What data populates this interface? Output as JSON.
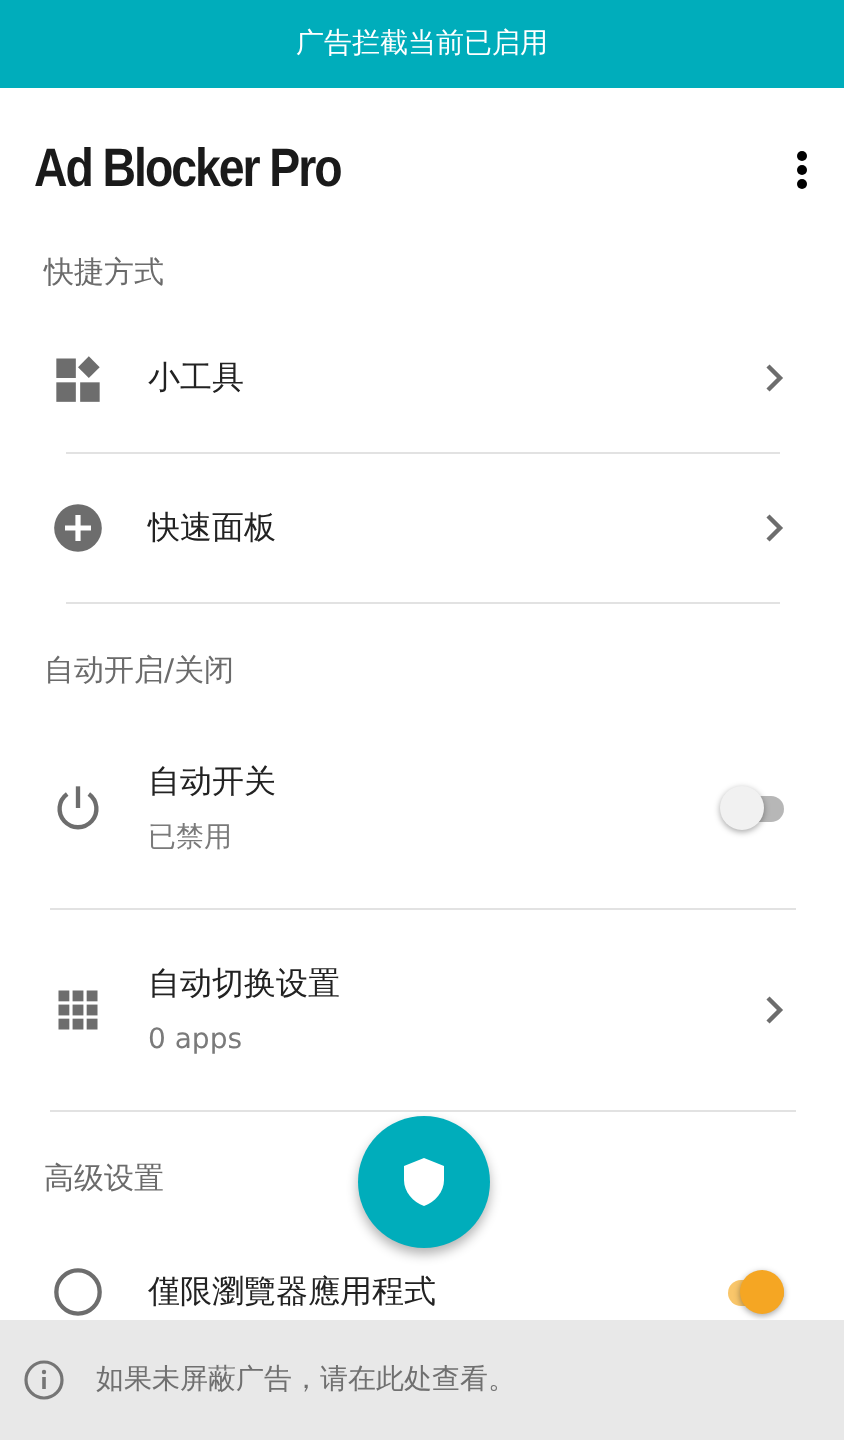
{
  "status_banner": "广告拦截当前已启用",
  "app_bar": {
    "title": "Ad Blocker Pro"
  },
  "sections": [
    {
      "header": "快捷方式",
      "items": [
        {
          "kind": "link",
          "title": "小工具"
        },
        {
          "kind": "link",
          "title": "快速面板"
        }
      ]
    },
    {
      "header": "自动开启/关闭",
      "items": [
        {
          "kind": "toggle",
          "title": "自动开关",
          "subtitle": "已禁用",
          "checked": false
        },
        {
          "kind": "link",
          "title": "自动切换设置",
          "subtitle": "0 apps"
        }
      ]
    },
    {
      "header": "高级设置",
      "items": [
        {
          "kind": "toggle",
          "title": "僅限瀏覽器應用程式",
          "checked": true
        }
      ]
    }
  ],
  "bottom_notice": "如果未屏蔽广告，请在此处查看。"
}
